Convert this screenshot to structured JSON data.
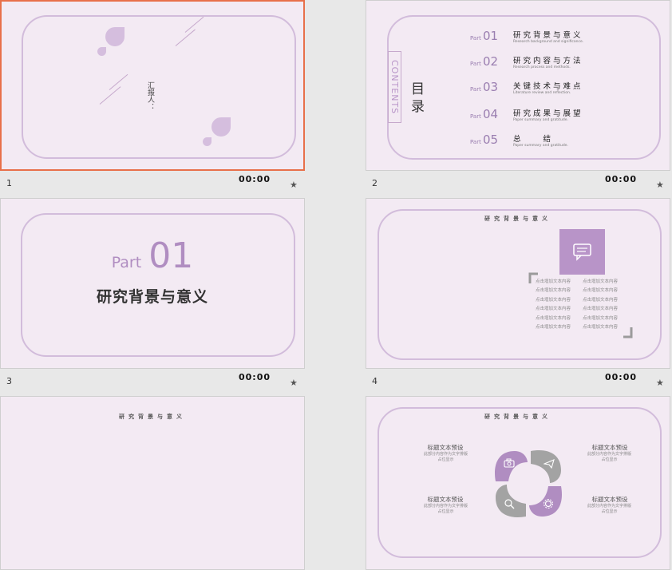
{
  "slides": [
    {
      "number": "1",
      "time": "00:00"
    },
    {
      "number": "2",
      "time": "00:00"
    },
    {
      "number": "3",
      "time": "00:00"
    },
    {
      "number": "4",
      "time": "00:00"
    },
    {
      "number": "5",
      "time": ""
    },
    {
      "number": "6",
      "time": ""
    }
  ],
  "star_glyph": "★",
  "slide1": {
    "reporter": "汇报人："
  },
  "slide2": {
    "contents_label": "CONTENTS",
    "heading": "目录",
    "items": [
      {
        "part": "Part",
        "num": "01",
        "title": "研究背景与意义",
        "sub": "Research background and significance."
      },
      {
        "part": "Part",
        "num": "02",
        "title": "研究内容与方法",
        "sub": "Research process and methods."
      },
      {
        "part": "Part",
        "num": "03",
        "title": "关键技术与难点",
        "sub": "Literature review and reflection."
      },
      {
        "part": "Part",
        "num": "04",
        "title": "研究成果与展望",
        "sub": "Paper summary and gratitude."
      },
      {
        "part": "Part",
        "num": "05",
        "title": "总　　结",
        "sub": "Paper summary and gratitude."
      }
    ]
  },
  "slide3": {
    "part": "Part",
    "num": "01",
    "title": "研究背景与意义"
  },
  "slide4": {
    "title": "研究背景与意义",
    "cells": [
      "点击增加文本内容",
      "点击增加文本内容",
      "点击增加文本内容",
      "点击增加文本内容",
      "点击增加文本内容",
      "点击增加文本内容"
    ]
  },
  "slide5": {
    "title": "研究背景与意义"
  },
  "slide6": {
    "title": "研究背景与意义",
    "captions": [
      {
        "title": "标题文本预设",
        "desc": "此部分内容作为文字排版占位显示"
      },
      {
        "title": "标题文本预设",
        "desc": "此部分内容作为文字排版占位显示"
      },
      {
        "title": "标题文本预设",
        "desc": "此部分内容作为文字排版占位显示"
      },
      {
        "title": "标题文本预设",
        "desc": "此部分内容作为文字排版占位显示"
      }
    ]
  },
  "colors": {
    "accent": "#9a7eb0",
    "frame": "#d2bcdb",
    "petal_purple": "#b08dc1",
    "petal_gray": "#a3a3a3",
    "selection": "#e8704a",
    "slide_bg": "#f3eaf3"
  },
  "icons": [
    "star-icon",
    "chat-icon",
    "camera-icon",
    "send-icon",
    "search-icon",
    "gear-icon"
  ]
}
